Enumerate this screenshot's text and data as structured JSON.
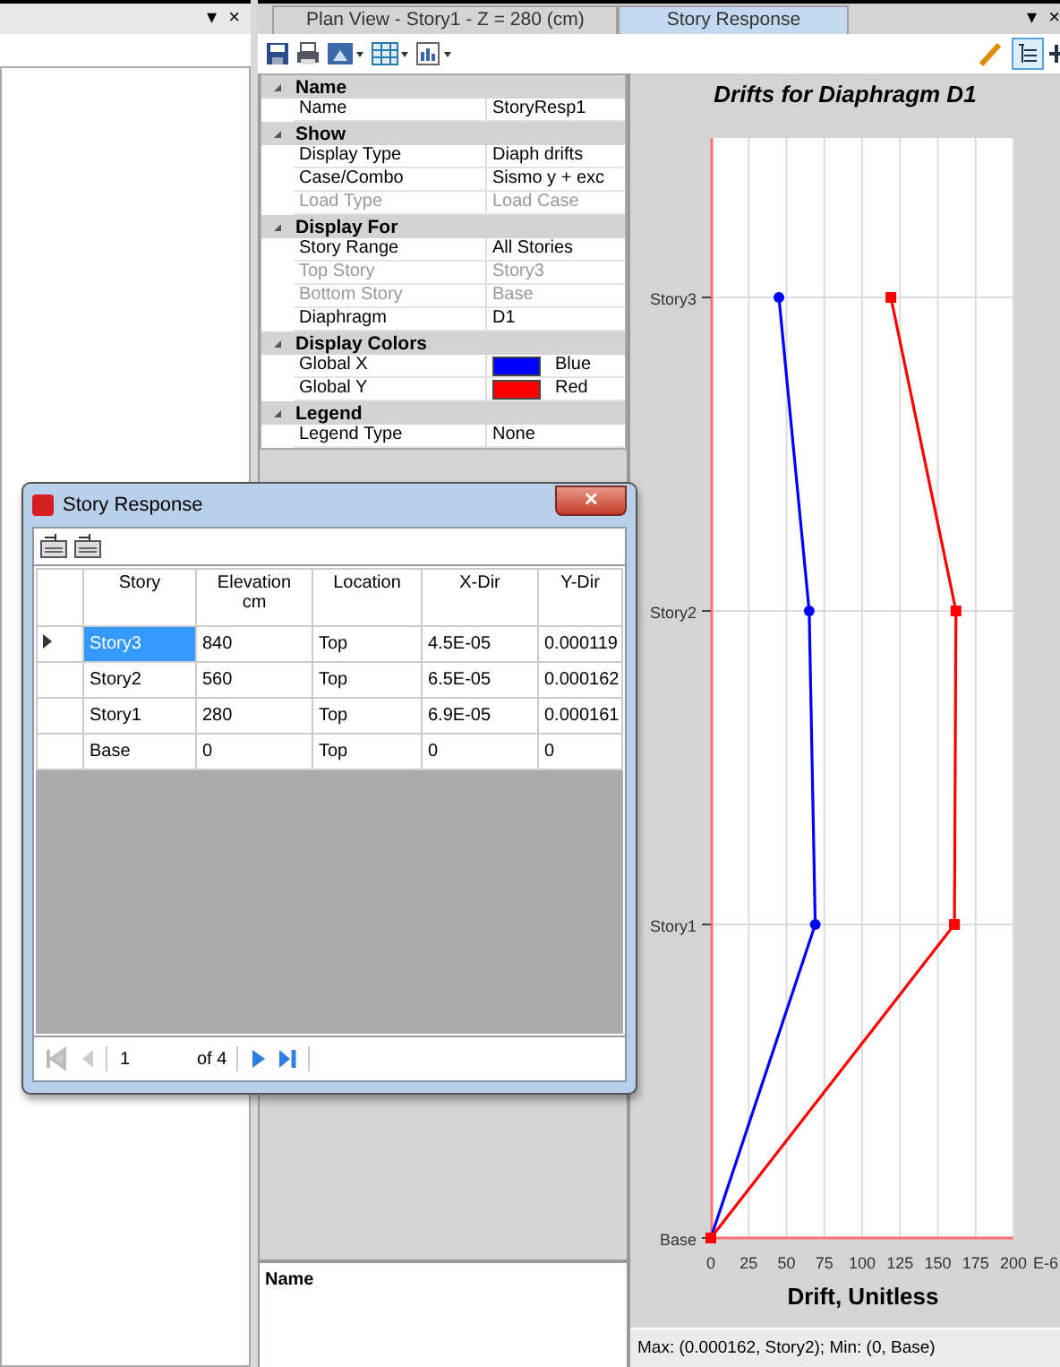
{
  "left_panel": {
    "menu_glyph": "▾",
    "close_glyph": "×"
  },
  "tabs": [
    {
      "label": "Plan View - Story1 - Z = 280 (cm)",
      "selected": false
    },
    {
      "label": "Story Response",
      "selected": true
    }
  ],
  "tab_strip": {
    "menu_glyph": "▾",
    "close_glyph": "×"
  },
  "property_grid": [
    {
      "name": "Name",
      "expanded": true,
      "rows": [
        {
          "label": "Name",
          "value": "StoryResp1",
          "disabled": false
        }
      ]
    },
    {
      "name": "Show",
      "expanded": true,
      "rows": [
        {
          "label": "Display Type",
          "value": "Diaph drifts",
          "disabled": false
        },
        {
          "label": "Case/Combo",
          "value": "Sismo y + exc",
          "disabled": false
        },
        {
          "label": "Load Type",
          "value": "Load Case",
          "disabled": true
        }
      ]
    },
    {
      "name": "Display For",
      "expanded": true,
      "rows": [
        {
          "label": "Story Range",
          "value": "All Stories",
          "disabled": false
        },
        {
          "label": "Top Story",
          "value": "Story3",
          "disabled": true
        },
        {
          "label": "Bottom Story",
          "value": "Base",
          "disabled": true
        },
        {
          "label": "Diaphragm",
          "value": "D1",
          "disabled": false
        }
      ]
    },
    {
      "name": "Display Colors",
      "expanded": true,
      "rows": [
        {
          "label": "Global X",
          "value": "Blue",
          "color": "#0000ff",
          "disabled": false
        },
        {
          "label": "Global Y",
          "value": "Red",
          "color": "#ff0000",
          "disabled": false
        }
      ]
    },
    {
      "name": "Legend",
      "expanded": true,
      "rows": [
        {
          "label": "Legend Type",
          "value": "None",
          "disabled": false
        }
      ]
    }
  ],
  "description_panel": {
    "title": "Name"
  },
  "chart": {
    "chart_data": {
      "type": "line",
      "orientation": "horizontal",
      "title": "Drifts for Diaphragm D1",
      "xlabel": "Drift, Unitless",
      "categories": [
        "Story3",
        "Story2",
        "Story1",
        "Base"
      ],
      "grid": true,
      "series": [
        {
          "color": "#0000ff",
          "marker": "circle",
          "values": [
            45,
            65,
            69,
            0
          ]
        },
        {
          "color": "#ff0000",
          "marker": "square",
          "values": [
            119,
            162,
            161,
            0
          ]
        }
      ],
      "xlim": [
        0,
        200
      ],
      "xticks": [
        0,
        25,
        50,
        75,
        100,
        125,
        150,
        175,
        200
      ]
    },
    "scale_label": "E-6"
  },
  "status_bar": "Max: (0.000162, Story2);   Min: (0, Base)",
  "dialog": {
    "title": "Story Response",
    "close_glyph": "✕",
    "columns": [
      {
        "label": "Story"
      },
      {
        "label": "Elevation",
        "unit": "cm"
      },
      {
        "label": "Location"
      },
      {
        "label": "X-Dir"
      },
      {
        "label": "Y-Dir"
      }
    ],
    "rows": [
      {
        "selected": true,
        "cells": [
          "Story3",
          "840",
          "Top",
          "4.5E-05",
          "0.000119"
        ]
      },
      {
        "selected": false,
        "cells": [
          "Story2",
          "560",
          "Top",
          "6.5E-05",
          "0.000162"
        ]
      },
      {
        "selected": false,
        "cells": [
          "Story1",
          "280",
          "Top",
          "6.9E-05",
          "0.000161"
        ]
      },
      {
        "selected": false,
        "cells": [
          "Base",
          "0",
          "Top",
          "0",
          "0"
        ]
      }
    ],
    "pager": {
      "page": "1",
      "of": "of 4"
    }
  }
}
